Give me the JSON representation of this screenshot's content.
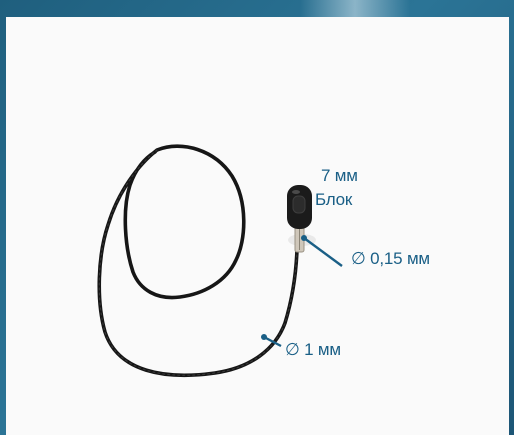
{
  "annotations": {
    "capsule_size": "7 мм",
    "capsule_name": "Блок",
    "thin_wire_diameter": "∅ 0,15 мм",
    "thick_wire_diameter": "∅ 1 мм"
  },
  "colors": {
    "frame": "#2b7496",
    "label_text": "#1a5f86",
    "leader_line": "#1a5f86",
    "background": "#fafafa",
    "cable": "#151515"
  }
}
